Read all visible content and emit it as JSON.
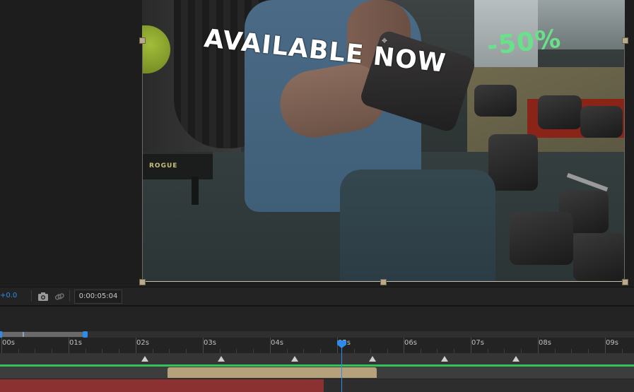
{
  "viewer": {
    "overlay_text_main": "AVAILABLE NOW",
    "overlay_text_percent": "-50%",
    "bench_brand": "ROGUE",
    "anchor_glyph": "⌖",
    "colors": {
      "text_main": "#ffffff",
      "text_percent": "#69e08a",
      "selection": "#b9ab8a"
    }
  },
  "viewer_footer": {
    "exposure_value": "+0.0",
    "timecode": "0:00:05:04",
    "camera_icon": "camera-icon",
    "link_icon": "link-icon"
  },
  "timeline": {
    "ruler_labels": [
      "00s",
      "01s",
      "02s",
      "03s",
      "04s",
      "05s",
      "06s",
      "07s",
      "08s",
      "09s"
    ],
    "playhead_time": "05s",
    "work_area_fraction": 0.12,
    "colors": {
      "playhead": "#2d8ceb",
      "green_bar": "#33c25a",
      "tan_clip": "#b6a27a",
      "red_clip": "#8b3131"
    }
  }
}
